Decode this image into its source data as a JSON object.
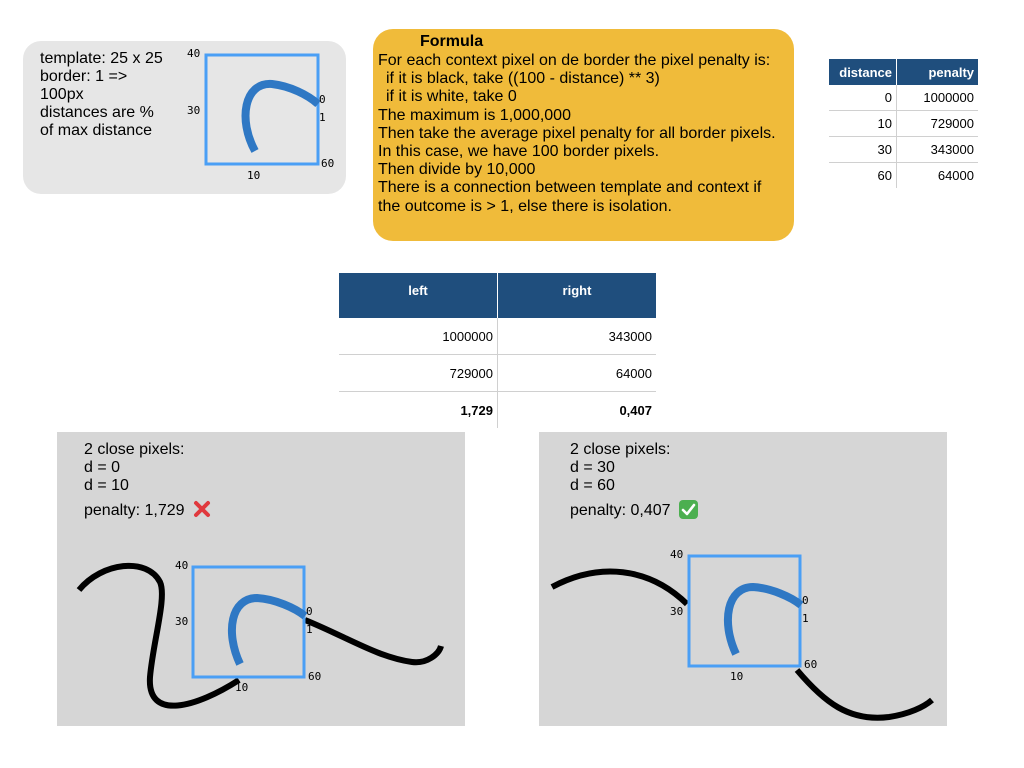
{
  "info": {
    "lines": [
      "template: 25 x 25",
      "border: 1 =>",
      "100px",
      "distances are %",
      "of max distance"
    ]
  },
  "template_labels": {
    "top_left": "40",
    "left": "30",
    "right_top": "0",
    "right_bottom": "1",
    "bottom_right": "60",
    "bottom": "10"
  },
  "formula": {
    "title": "Formula",
    "lines": [
      "For each context pixel on de border the pixel penalty is:",
      "  if it is black, take ((100 - distance) ** 3)",
      "  if it is white, take 0",
      "The maximum is 1,000,000",
      "Then take the average pixel penalty for all border pixels.",
      "In this case, we have 100 border pixels.",
      "Then divide by 10,000",
      "There is a connection between template and context if",
      "the outcome is > 1, else there is isolation."
    ]
  },
  "distance_table": {
    "headers": [
      "distance",
      "penalty"
    ],
    "rows": [
      [
        "0",
        "1000000"
      ],
      [
        "10",
        "729000"
      ],
      [
        "30",
        "343000"
      ],
      [
        "60",
        "64000"
      ]
    ]
  },
  "lr_table": {
    "headers": [
      "left",
      "right"
    ],
    "rows": [
      [
        "1000000",
        "343000"
      ],
      [
        "729000",
        "64000"
      ]
    ],
    "total": [
      "1,729",
      "0,407"
    ]
  },
  "panel_left": {
    "lines": [
      "2 close pixels:",
      "d = 0",
      "d = 10"
    ],
    "penalty": "penalty: 1,729"
  },
  "panel_right": {
    "lines": [
      "2 close pixels:",
      "d = 30",
      "d = 60"
    ],
    "penalty": "penalty: 0,407"
  },
  "colors": {
    "template_border": "#4a9ff5",
    "template_stroke": "#2f78c4",
    "context_stroke": "#000000",
    "formula_bg": "#f0bb3a",
    "table_header": "#1f4e7d"
  }
}
